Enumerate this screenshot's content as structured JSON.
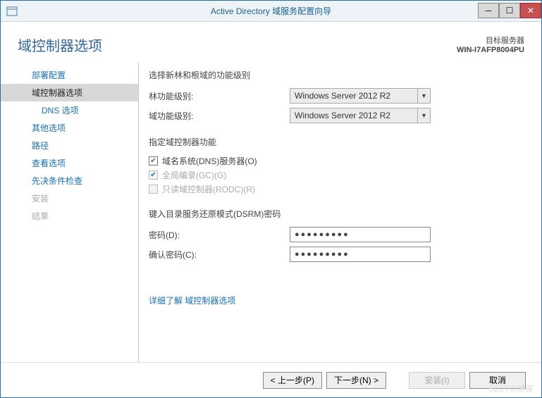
{
  "window": {
    "title": "Active Directory 域服务配置向导"
  },
  "header": {
    "page_title": "域控制器选项",
    "target_label": "目标服务器",
    "target_server": "WIN-I7AFP8004PU"
  },
  "sidebar": {
    "items": [
      {
        "label": "部署配置",
        "active": false
      },
      {
        "label": "域控制器选项",
        "active": true
      },
      {
        "label": "DNS 选项",
        "indent": true
      },
      {
        "label": "其他选项"
      },
      {
        "label": "路径"
      },
      {
        "label": "查看选项"
      },
      {
        "label": "先决条件检查"
      },
      {
        "label": "安装",
        "disabled": true
      },
      {
        "label": "结果",
        "disabled": true
      }
    ]
  },
  "main": {
    "section1": "选择新林和根域的功能级别",
    "forest_label": "林功能级别:",
    "forest_value": "Windows Server 2012 R2",
    "domain_label": "域功能级别:",
    "domain_value": "Windows Server 2012 R2",
    "section2": "指定域控制器功能",
    "cb_dns": "域名系统(DNS)服务器(O)",
    "cb_gc": "全局编录(GC)(G)",
    "cb_rodc": "只读域控制器(RODC)(R)",
    "section3": "键入目录服务还原模式(DSRM)密码",
    "pw_label": "密码(D):",
    "pw_value": "●●●●●●●●●",
    "pw2_label": "确认密码(C):",
    "pw2_value": "●●●●●●●●●",
    "more_link": "详细了解 域控制器选项"
  },
  "footer": {
    "prev": "< 上一步(P)",
    "next": "下一步(N) >",
    "install": "安装(I)",
    "cancel": "取消",
    "watermark": "51CTO博客"
  }
}
